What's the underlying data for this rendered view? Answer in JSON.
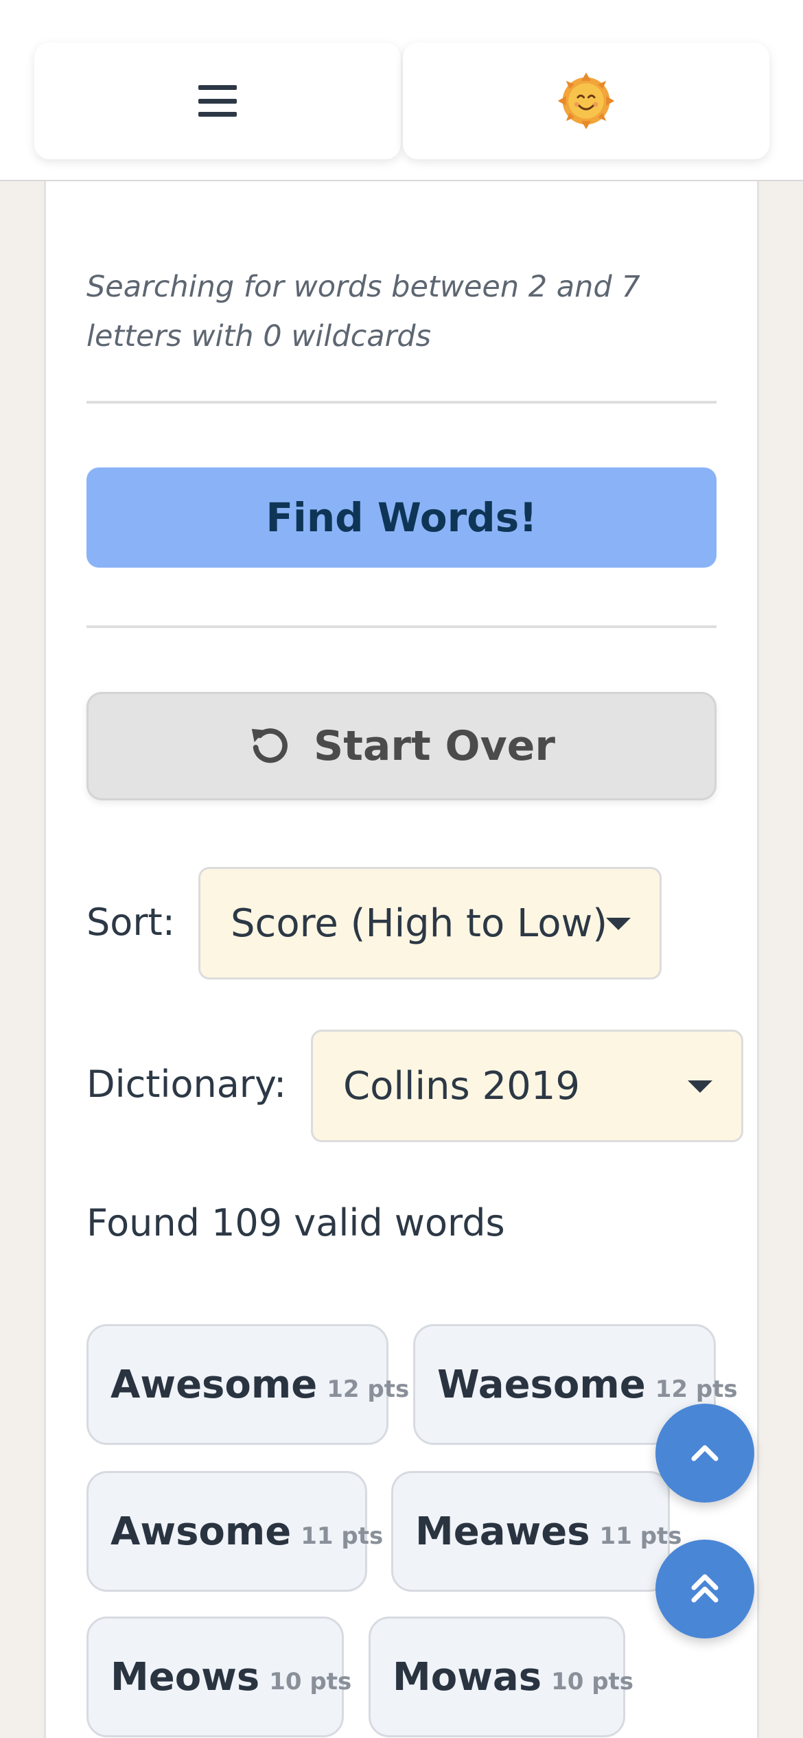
{
  "header": {
    "menu_icon": "hamburger-menu-icon",
    "theme_icon": "smiling-sun-icon"
  },
  "search": {
    "note": "Searching for words between 2 and 7 letters with 0 wildcards"
  },
  "actions": {
    "find_label": "Find Words!",
    "start_over_label": "Start Over",
    "start_over_icon": "reset-icon"
  },
  "sort": {
    "label": "Sort:",
    "selected": "Score (High to Low)"
  },
  "dictionary": {
    "label": "Dictionary:",
    "selected": "Collins 2019"
  },
  "results": {
    "summary": "Found 109 valid words",
    "words": [
      {
        "word": "Awesome",
        "pts": "12 pts"
      },
      {
        "word": "Waesome",
        "pts": "12 pts"
      },
      {
        "word": "Awsome",
        "pts": "11 pts"
      },
      {
        "word": "Meawes",
        "pts": "11 pts"
      },
      {
        "word": "Meows",
        "pts": "10 pts"
      },
      {
        "word": "Mowas",
        "pts": "10 pts"
      }
    ]
  },
  "fabs": {
    "scroll_up_icon": "chevron-up-icon",
    "scroll_top_icon": "double-chevron-up-icon"
  },
  "colors": {
    "accent": "#8ab3f7",
    "fab": "#4a86d6",
    "select_bg": "#fdf6e3",
    "chip_bg": "#f0f3f8"
  }
}
